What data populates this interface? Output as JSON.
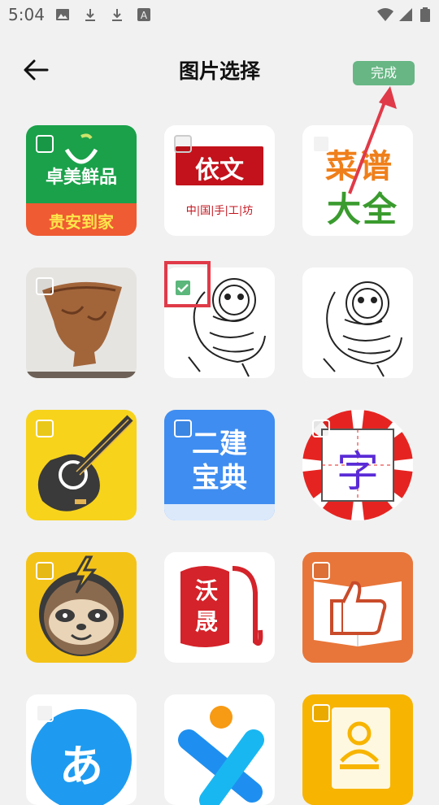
{
  "status_bar": {
    "time": "5:04",
    "icons": [
      "image-icon",
      "download-icon",
      "download-icon",
      "a-text-icon",
      "wifi-icon",
      "signal-icon",
      "battery-icon"
    ]
  },
  "header": {
    "title": "图片选择",
    "done_label": "完成"
  },
  "tiles": [
    {
      "name": "卓美鲜品",
      "line1": "卓美鲜品",
      "line2": "贵安到家",
      "checked": false
    },
    {
      "name": "依文",
      "line1": "依文",
      "line2": "中|国|手|工|坊",
      "checked": false
    },
    {
      "name": "菜谱大全",
      "line1": "菜谱",
      "line2": "大全",
      "checked": false
    },
    {
      "name": "vessel-photo",
      "checked": false
    },
    {
      "name": "paper-cut-figure",
      "checked": true
    },
    {
      "name": "paper-cut-figure-2",
      "checked": false
    },
    {
      "name": "guitar",
      "checked": false
    },
    {
      "name": "二建宝典",
      "line1": "二建",
      "line2": "宝典",
      "checked": false
    },
    {
      "name": "字",
      "line1": "字",
      "checked": false
    },
    {
      "name": "sloth",
      "checked": false
    },
    {
      "name": "沃晟",
      "line1": "沃",
      "line2": "晟",
      "checked": false
    },
    {
      "name": "thumbs-up-book",
      "checked": false
    },
    {
      "name": "あ",
      "line1": "あ",
      "checked": false
    },
    {
      "name": "x-figure",
      "checked": false
    },
    {
      "name": "person-book",
      "checked": false
    }
  ],
  "colors": {
    "done_button": "#67b684",
    "check_green": "#5bb77b",
    "highlight_red": "#e03a48",
    "arrow_red": "#e03a48"
  }
}
